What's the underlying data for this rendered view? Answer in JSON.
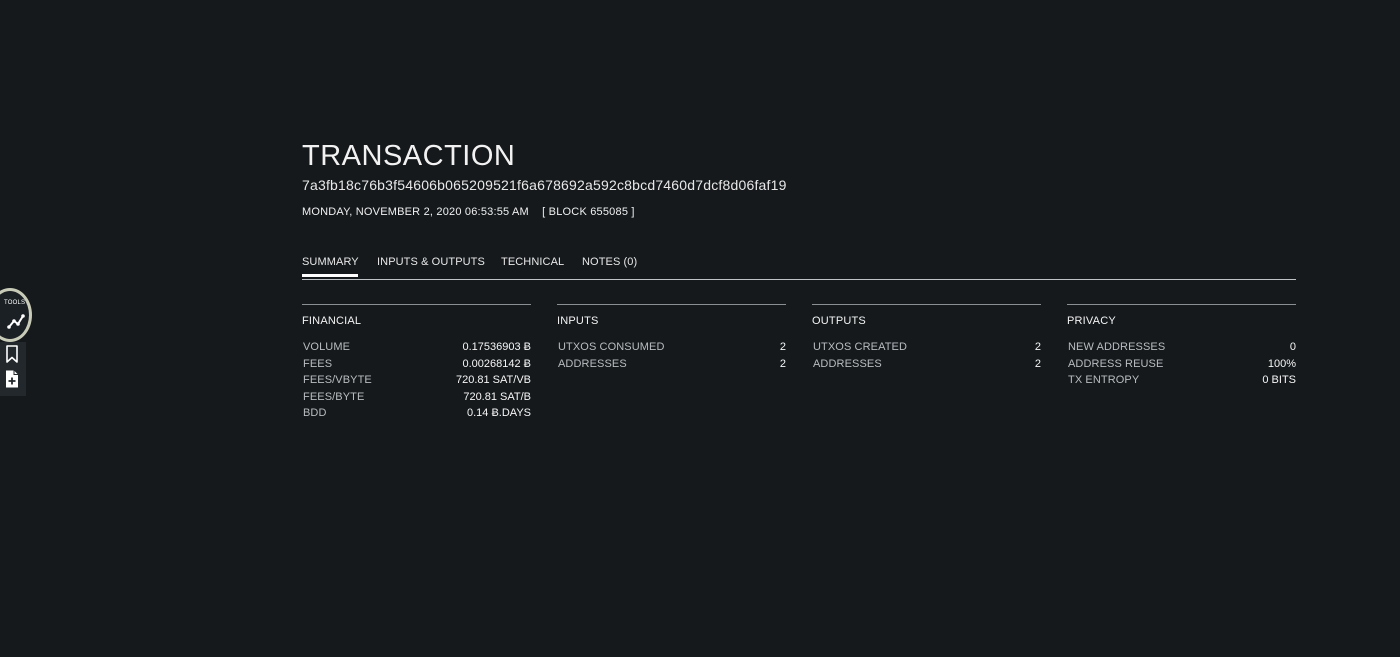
{
  "tools": {
    "label": "TOOLS",
    "buttons": [
      {
        "icon": "chart-line-icon"
      },
      {
        "icon": "bookmark-icon"
      },
      {
        "icon": "add-file-icon"
      }
    ]
  },
  "header": {
    "title": "TRANSACTION",
    "txid": "7a3fb18c76b3f54606b065209521f6a678692a592c8bcd7460d7dcf8d06faf19",
    "datetime": "MONDAY, NOVEMBER 2, 2020 06:53:55 AM",
    "block": "[ BLOCK 655085 ]"
  },
  "tabs": [
    {
      "label": "SUMMARY",
      "active": true
    },
    {
      "label": "INPUTS & OUTPUTS",
      "active": false
    },
    {
      "label": "TECHNICAL",
      "active": false
    },
    {
      "label": "NOTES (0)",
      "active": false
    }
  ],
  "panels": {
    "financial": {
      "title": "FINANCIAL",
      "rows": [
        {
          "label": "VOLUME",
          "value": "0.17536903 Ƀ"
        },
        {
          "label": "FEES",
          "value": "0.00268142 Ƀ"
        },
        {
          "label": "FEES/VBYTE",
          "value": "720.81 SAT/VB"
        },
        {
          "label": "FEES/BYTE",
          "value": "720.81 SAT/B"
        },
        {
          "label": "BDD",
          "value": "0.14 Ƀ.DAYS"
        }
      ]
    },
    "inputs": {
      "title": "INPUTS",
      "rows": [
        {
          "label": "UTXOS CONSUMED",
          "value": "2"
        },
        {
          "label": "ADDRESSES",
          "value": "2"
        }
      ]
    },
    "outputs": {
      "title": "OUTPUTS",
      "rows": [
        {
          "label": "UTXOS CREATED",
          "value": "2"
        },
        {
          "label": "ADDRESSES",
          "value": "2"
        }
      ]
    },
    "privacy": {
      "title": "PRIVACY",
      "rows": [
        {
          "label": "NEW ADDRESSES",
          "value": "0"
        },
        {
          "label": "ADDRESS REUSE",
          "value": "100%"
        },
        {
          "label": "TX ENTROPY",
          "value": "0 BITS"
        }
      ]
    }
  },
  "colors": {
    "background": "#15191c",
    "text": "#e6e6e6",
    "muted": "#b9bdc0",
    "tools_ring": "#c8cbb7"
  }
}
